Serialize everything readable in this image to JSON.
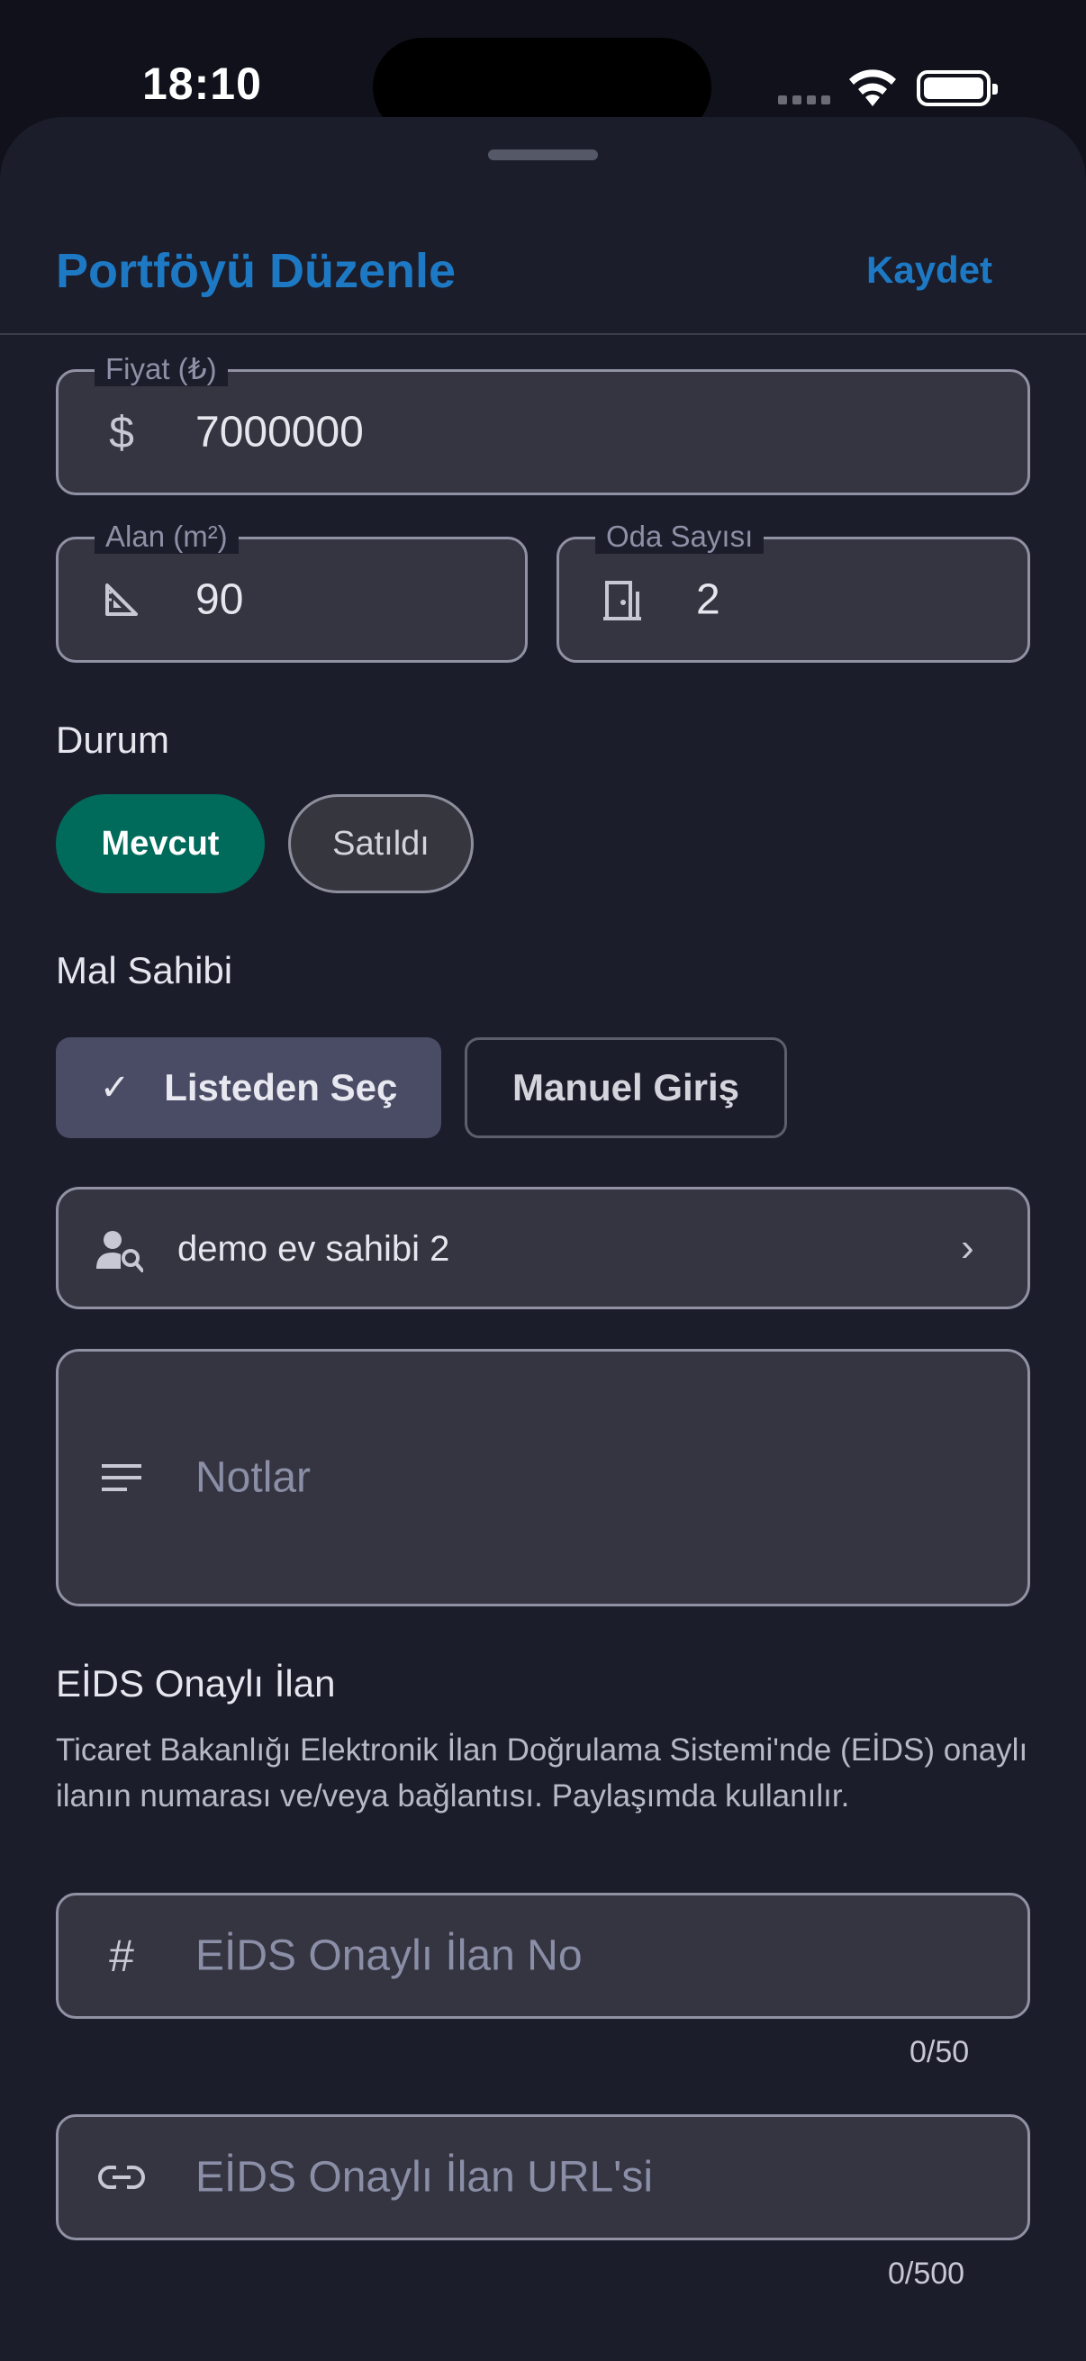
{
  "status_bar": {
    "time": "18:10"
  },
  "header": {
    "title": "Portföyü Düzenle",
    "save_label": "Kaydet"
  },
  "price": {
    "label": "Fiyat (₺)",
    "icon": "dollar-icon",
    "value": "7000000"
  },
  "area": {
    "label": "Alan (m²)",
    "icon": "set-square-icon",
    "value": "90"
  },
  "rooms": {
    "label": "Oda Sayısı",
    "icon": "door-icon",
    "value": "2"
  },
  "status": {
    "label": "Durum",
    "options": [
      {
        "label": "Mevcut",
        "selected": true
      },
      {
        "label": "Satıldı",
        "selected": false
      }
    ]
  },
  "owner": {
    "label": "Mal Sahibi",
    "modes": [
      {
        "label": "Listeden Seç",
        "selected": true
      },
      {
        "label": "Manuel Giriş",
        "selected": false
      }
    ],
    "selected_name": "demo ev sahibi 2"
  },
  "notes": {
    "placeholder": "Notlar",
    "icon": "notes-icon"
  },
  "eids": {
    "title": "EİDS Onaylı İlan",
    "description": "Ticaret Bakanlığı Elektronik İlan Doğrulama Sistemi'nde (EİDS) onaylı ilanın numarası ve/veya bağlantısı. Paylaşımda kullanılır.",
    "number_placeholder": "EİDS Onaylı İlan No",
    "number_counter": "0/50",
    "url_placeholder": "EİDS Onaylı İlan URL'si",
    "url_counter": "0/500"
  },
  "colors": {
    "accent": "#1d79c4",
    "selected_chip": "#006b5a",
    "sheet_bg": "#1b1d2b",
    "field_bg": "#353541"
  }
}
